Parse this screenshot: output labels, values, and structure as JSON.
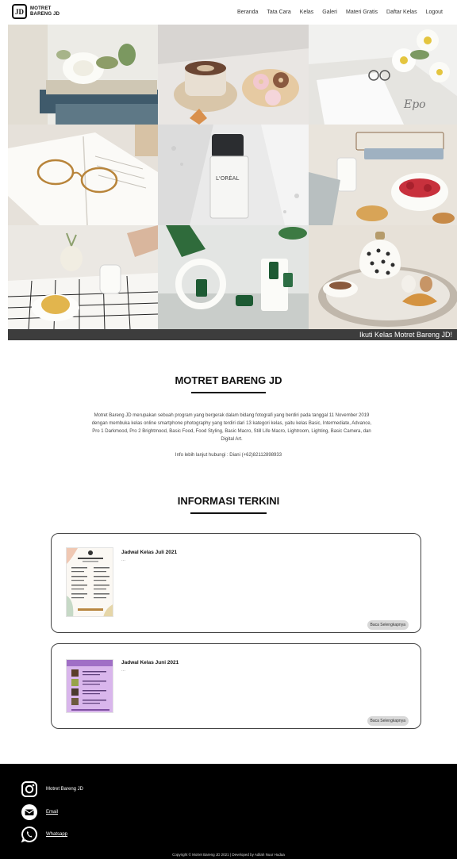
{
  "brand": {
    "logo_mark": "JD",
    "name_line1": "MOTRET",
    "name_line2": "BARENG JD"
  },
  "nav": {
    "items": [
      {
        "label": "Beranda"
      },
      {
        "label": "Tata Cara"
      },
      {
        "label": "Kelas"
      },
      {
        "label": "Galeri"
      },
      {
        "label": "Materi Gratis"
      },
      {
        "label": "Daftar Kelas"
      },
      {
        "label": "Logout"
      }
    ]
  },
  "hero": {
    "caption": "Ikuti Kelas Motret Bareng JD!"
  },
  "about": {
    "title": "MOTRET BARENG JD",
    "description": "Motret Bareng JD merupakan sebuah program yang bergerak dalam bidang fotografi yang berdiri pada tanggal 11 November 2019 dengan membuka kelas online smartphone photography yang terdiri dari 13 kategori kelas, yaitu kelas Basic, Intermediate, Advance, Pro 1 Darkmood, Pro 2 Brightmood, Basic Food, Food Styling, Basic Macro, Still Life Macro, Lightroom, Lighting, Basic Camera, dan Digital Art.",
    "contact": "Info lebih lanjut hubungi : Diani (+62)82112898933"
  },
  "news": {
    "title": "INFORMASI TERKINI",
    "button_label": "Baca Selengkapnya",
    "items": [
      {
        "title": "Jadwal Kelas Juli 2021",
        "snippet": "..."
      },
      {
        "title": "Jadwal Kelas Juni 2021",
        "snippet": "..."
      }
    ]
  },
  "footer": {
    "instagram": "Motret Bareng JD",
    "email": "Email",
    "whatsapp": "Whatsapp",
    "copyright": "Copyright © Motret Bareng JD 2021 | Developed by Adilah Nuur Hudaa"
  },
  "colors": {
    "footer_bg": "#000000",
    "caption_bar": "#3d3d3d",
    "card_border": "#444444"
  }
}
